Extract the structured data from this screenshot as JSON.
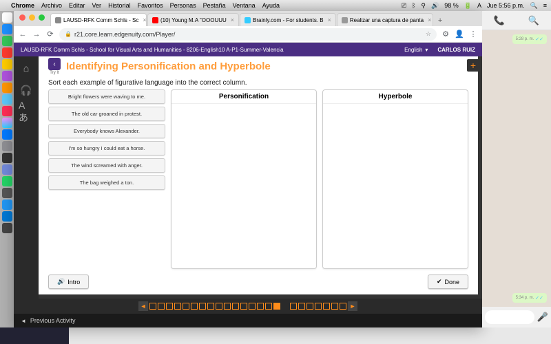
{
  "menubar": {
    "app": "Chrome",
    "items": [
      "Archivo",
      "Editar",
      "Ver",
      "Historial",
      "Favoritos",
      "Personas",
      "Pestaña",
      "Ventana",
      "Ayuda"
    ],
    "battery": "98 %",
    "clock": "Jue 5:56 p.m."
  },
  "tabs": [
    {
      "label": "LAUSD-RFK Comm Schls - Sc",
      "favicon": "#888"
    },
    {
      "label": "(10) Young M.A \"OOOUUU",
      "favicon": "#f00"
    },
    {
      "label": "Brainly.com - For students. B",
      "favicon": "#3cf"
    },
    {
      "label": "Realizar una captura de panta",
      "favicon": "#999"
    }
  ],
  "url": "r21.core.learn.edgenuity.com/Player/",
  "purple": {
    "course": "LAUSD-RFK Comm Schls - School for Visual Arts and Humanities - 8206-English10 A-P1-Summer-Valencia",
    "lang": "English",
    "user": "CARLOS RUIZ"
  },
  "lesson": {
    "tryit": "Try It",
    "title": "Identifying Personification and Hyperbole",
    "instruction": "Sort each example of figurative language into the correct column.",
    "cards": [
      "Bright flowers were waving to me.",
      "The old car groaned in protest.",
      "Everybody knows Alexander.",
      "I'm so hungry I could eat a horse.",
      "The wind screamed with anger.",
      "The bag weighed a ton."
    ],
    "col1": "Personification",
    "col2": "Hyperbole",
    "intro": "Intro",
    "done": "Done"
  },
  "prevActivity": "Previous Activity",
  "whatsapp": {
    "msg1": "5:28 p. m.",
    "msg2": "5:34 p. m."
  }
}
